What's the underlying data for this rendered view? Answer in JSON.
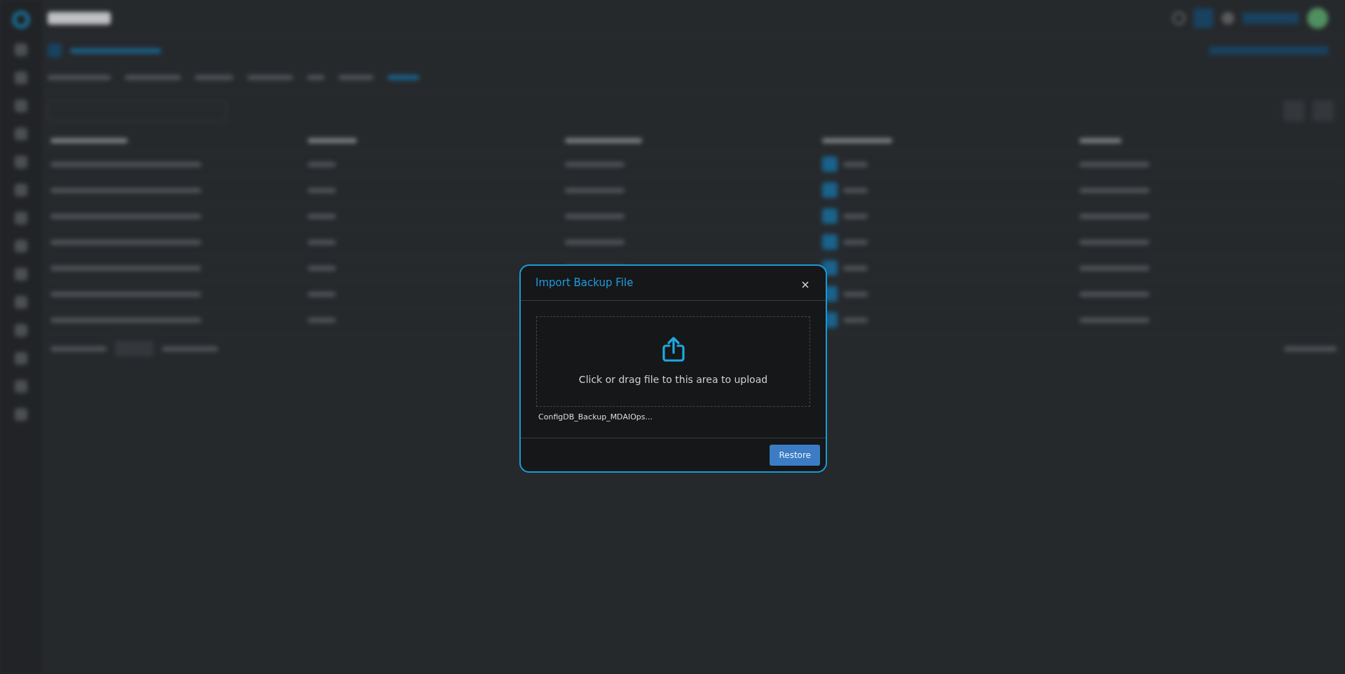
{
  "dialog": {
    "title": "Import Backup File",
    "dropzone": {
      "hint": "Click or drag file to this area to upload"
    },
    "file": {
      "name": "ConfigDB_Backup_MDAIOps..."
    },
    "buttons": [
      {
        "label": "Restore",
        "kind": "primary"
      }
    ]
  }
}
